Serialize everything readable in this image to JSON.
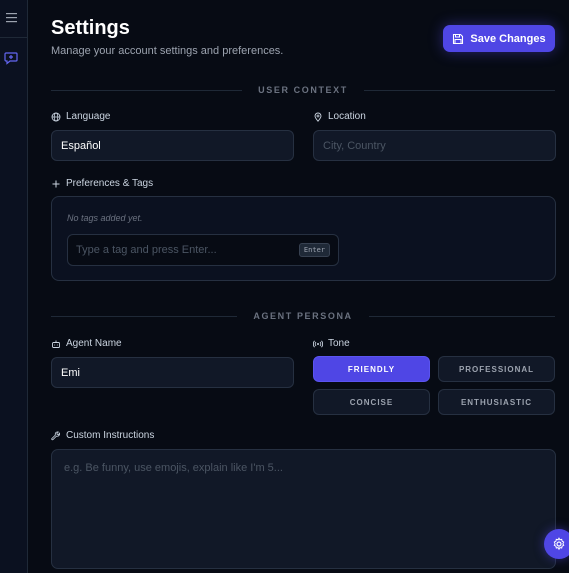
{
  "page": {
    "title": "Settings",
    "subtitle": "Manage your account settings and preferences."
  },
  "toolbar": {
    "save_label": "Save Changes"
  },
  "sections": {
    "user_context": "USER CONTEXT",
    "agent_persona": "AGENT PERSONA"
  },
  "fields": {
    "language": {
      "label": "Language",
      "value": "Español"
    },
    "location": {
      "label": "Location",
      "placeholder": "City, Country"
    },
    "preferences": {
      "label": "Preferences & Tags",
      "empty_text": "No tags added yet.",
      "input_placeholder": "Type a tag and press Enter...",
      "key_hint": "Enter"
    },
    "agent_name": {
      "label": "Agent Name",
      "value": "Emi"
    },
    "tone": {
      "label": "Tone",
      "options": [
        "FRIENDLY",
        "PROFESSIONAL",
        "CONCISE",
        "ENTHUSIASTIC"
      ],
      "selected": "FRIENDLY"
    },
    "custom_instructions": {
      "label": "Custom Instructions",
      "placeholder": "e.g. Be funny, use emojis, explain like I'm 5..."
    }
  },
  "icons": {
    "sidebar_toggle": "hamburger-menu-icon",
    "new_chat": "message-plus-icon",
    "save": "floppy-disk-icon",
    "language": "globe-icon",
    "location": "map-pin-icon",
    "preferences": "plus-icon",
    "agent_name": "bot-icon",
    "tone": "radio-waves-icon",
    "custom_instructions": "wrench-icon",
    "settings_fab": "gear-icon"
  },
  "colors": {
    "accent": "#4f46e5",
    "background": "#070b14",
    "surface": "#111827"
  }
}
